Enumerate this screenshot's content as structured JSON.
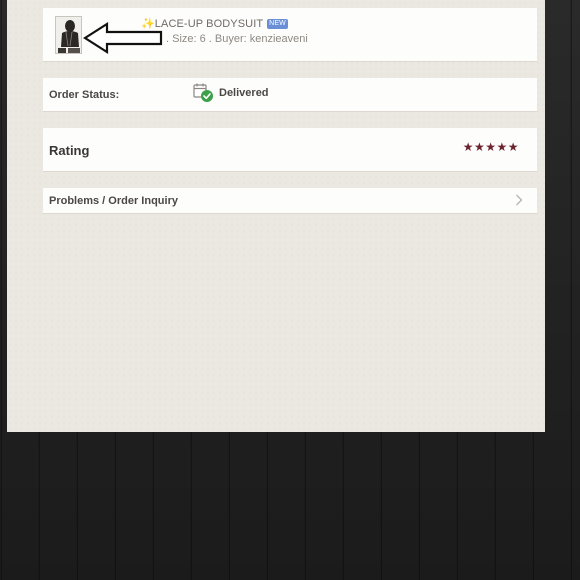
{
  "item": {
    "sparkle": "✨",
    "title": "LACE-UP BODYSUIT",
    "new_badge": "NEW",
    "subtitle": ". Size: 6 . Buyer: kenzieaveni",
    "thumbnail_icon": "product-photo"
  },
  "order_status": {
    "label": "Order Status:",
    "value": "Delivered",
    "icon": "delivered-calendar-check-icon"
  },
  "rating": {
    "label": "Rating",
    "stars_text": "★★★★★",
    "value": 5,
    "max": 5
  },
  "problems": {
    "label": "Problems / Order Inquiry",
    "icon": "chevron-right-icon"
  },
  "colors": {
    "screen_bg": "#ebe8e1",
    "card_bg": "#fdfdfc",
    "star": "#6e2430",
    "check": "#3ca14a",
    "text_dark": "#4a4744"
  }
}
